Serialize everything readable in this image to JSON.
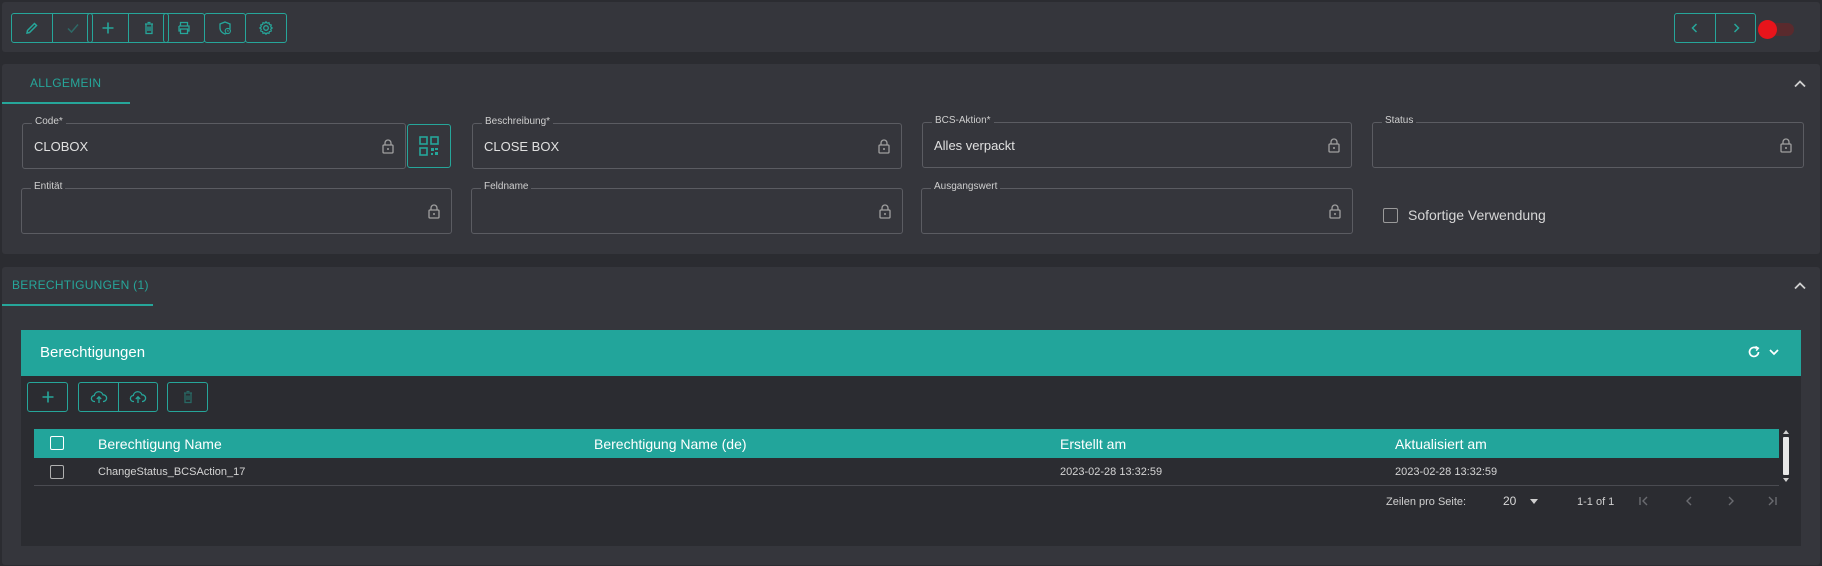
{
  "toolbar": {
    "groups": [
      {
        "buttons": [
          "edit-icon",
          "check-icon"
        ]
      },
      {
        "buttons": [
          "plus-icon",
          "trash-icon"
        ]
      },
      {
        "buttons": [
          "printer-icon"
        ]
      },
      {
        "buttons": [
          "shield-clock-icon"
        ]
      },
      {
        "buttons": [
          "gear-icon"
        ]
      }
    ],
    "nav": [
      "chevron-left-icon",
      "chevron-right-icon"
    ],
    "toggle_color": "#e8141b"
  },
  "allgemein": {
    "tab_label": "ALLGEMEIN",
    "fields": {
      "code": {
        "label": "Code*",
        "value": "CLOBOX"
      },
      "beschreibung": {
        "label": "Beschreibung*",
        "value": "CLOSE BOX"
      },
      "bcs_aktion": {
        "label": "BCS-Aktion*",
        "value": "Alles verpackt"
      },
      "status": {
        "label": "Status",
        "value": ""
      },
      "entitaet": {
        "label": "Entität",
        "value": ""
      },
      "feldname": {
        "label": "Feldname",
        "value": ""
      },
      "ausgangswert": {
        "label": "Ausgangswert",
        "value": ""
      }
    },
    "checkbox_label": "Sofortige Verwendung"
  },
  "berechtigungen": {
    "tab_label": "BERECHTIGUNGEN (1)",
    "panel_title": "Berechtigungen",
    "columns": [
      "Berechtigung Name",
      "Berechtigung Name (de)",
      "Erstellt am",
      "Aktualisiert am"
    ],
    "rows": [
      {
        "name": "ChangeStatus_BCSAction_17",
        "name_de": "",
        "created": "2023-02-28 13:32:59",
        "updated": "2023-02-28 13:32:59"
      }
    ],
    "pager": {
      "rows_label": "Zeilen pro Seite:",
      "rows_value": "20",
      "range": "1-1 of 1"
    }
  },
  "colors": {
    "accent": "#26a69a",
    "background": "#2b2c31",
    "surface": "#35363c"
  }
}
